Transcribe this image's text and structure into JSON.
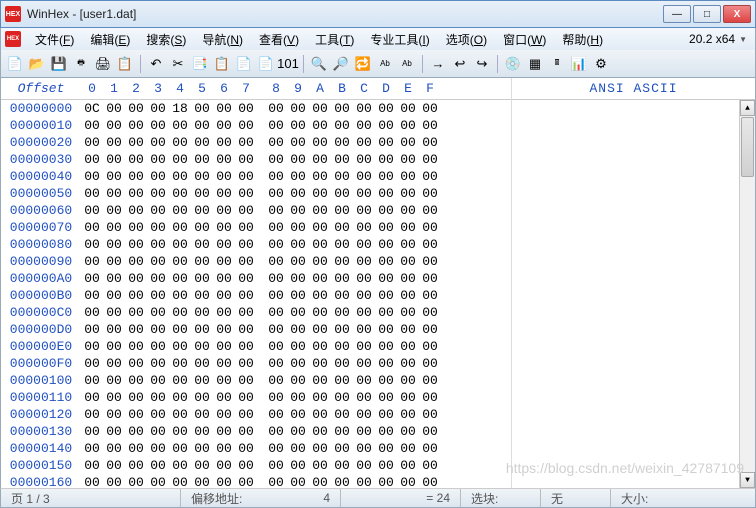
{
  "window": {
    "title": "WinHex - [user1.dat]",
    "app_abbr": "HEX"
  },
  "win_controls": {
    "min": "—",
    "max": "□",
    "close": "X"
  },
  "menu": {
    "items": [
      {
        "label": "文件",
        "key": "F"
      },
      {
        "label": "编辑",
        "key": "E"
      },
      {
        "label": "搜索",
        "key": "S"
      },
      {
        "label": "导航",
        "key": "N"
      },
      {
        "label": "查看",
        "key": "V"
      },
      {
        "label": "工具",
        "key": "T"
      },
      {
        "label": "专业工具",
        "key": "I"
      },
      {
        "label": "选项",
        "key": "O"
      },
      {
        "label": "窗口",
        "key": "W"
      },
      {
        "label": "帮助",
        "key": "H"
      }
    ],
    "version": "20.2 x64"
  },
  "toolbar_icons": [
    {
      "name": "new-file-icon",
      "glyph": "📄"
    },
    {
      "name": "open-folder-icon",
      "glyph": "📂"
    },
    {
      "name": "save-icon",
      "glyph": "💾"
    },
    {
      "name": "save-as-icon",
      "glyph": "🖶"
    },
    {
      "name": "print-icon",
      "glyph": "🖨"
    },
    {
      "name": "properties-icon",
      "glyph": "📋"
    },
    {
      "name": "sep"
    },
    {
      "name": "undo-icon",
      "glyph": "↶"
    },
    {
      "name": "cut-icon",
      "glyph": "✂"
    },
    {
      "name": "copy-icon",
      "glyph": "📑"
    },
    {
      "name": "paste-icon",
      "glyph": "📋"
    },
    {
      "name": "copy-block-icon",
      "glyph": "📄"
    },
    {
      "name": "paste-block-icon",
      "glyph": "📄"
    },
    {
      "name": "binary-icon",
      "glyph": "101"
    },
    {
      "name": "sep"
    },
    {
      "name": "find-icon",
      "glyph": "🔍"
    },
    {
      "name": "find-hex-icon",
      "glyph": "🔎"
    },
    {
      "name": "replace-icon",
      "glyph": "🔁"
    },
    {
      "name": "find-text-icon",
      "glyph": "Ab"
    },
    {
      "name": "replace-text-icon",
      "glyph": "Ab"
    },
    {
      "name": "sep"
    },
    {
      "name": "goto-icon",
      "glyph": "→"
    },
    {
      "name": "back-icon",
      "glyph": "↩"
    },
    {
      "name": "forward-icon",
      "glyph": "↪"
    },
    {
      "name": "sep"
    },
    {
      "name": "disk-icon",
      "glyph": "💿"
    },
    {
      "name": "ram-icon",
      "glyph": "▦"
    },
    {
      "name": "calc-icon",
      "glyph": "🖩"
    },
    {
      "name": "analyze-icon",
      "glyph": "📊"
    },
    {
      "name": "settings-icon",
      "glyph": "⚙"
    }
  ],
  "hex": {
    "offset_label": "Offset",
    "columns": [
      "0",
      "1",
      "2",
      "3",
      "4",
      "5",
      "6",
      "7",
      "8",
      "9",
      "A",
      "B",
      "C",
      "D",
      "E",
      "F"
    ],
    "ascii_label": "ANSI ASCII",
    "rows": [
      {
        "offset": "00000000",
        "bytes": [
          "0C",
          "00",
          "00",
          "00",
          "18",
          "00",
          "00",
          "00",
          "00",
          "00",
          "00",
          "00",
          "00",
          "00",
          "00",
          "00"
        ]
      },
      {
        "offset": "00000010",
        "bytes": [
          "00",
          "00",
          "00",
          "00",
          "00",
          "00",
          "00",
          "00",
          "00",
          "00",
          "00",
          "00",
          "00",
          "00",
          "00",
          "00"
        ]
      },
      {
        "offset": "00000020",
        "bytes": [
          "00",
          "00",
          "00",
          "00",
          "00",
          "00",
          "00",
          "00",
          "00",
          "00",
          "00",
          "00",
          "00",
          "00",
          "00",
          "00"
        ]
      },
      {
        "offset": "00000030",
        "bytes": [
          "00",
          "00",
          "00",
          "00",
          "00",
          "00",
          "00",
          "00",
          "00",
          "00",
          "00",
          "00",
          "00",
          "00",
          "00",
          "00"
        ]
      },
      {
        "offset": "00000040",
        "bytes": [
          "00",
          "00",
          "00",
          "00",
          "00",
          "00",
          "00",
          "00",
          "00",
          "00",
          "00",
          "00",
          "00",
          "00",
          "00",
          "00"
        ]
      },
      {
        "offset": "00000050",
        "bytes": [
          "00",
          "00",
          "00",
          "00",
          "00",
          "00",
          "00",
          "00",
          "00",
          "00",
          "00",
          "00",
          "00",
          "00",
          "00",
          "00"
        ]
      },
      {
        "offset": "00000060",
        "bytes": [
          "00",
          "00",
          "00",
          "00",
          "00",
          "00",
          "00",
          "00",
          "00",
          "00",
          "00",
          "00",
          "00",
          "00",
          "00",
          "00"
        ]
      },
      {
        "offset": "00000070",
        "bytes": [
          "00",
          "00",
          "00",
          "00",
          "00",
          "00",
          "00",
          "00",
          "00",
          "00",
          "00",
          "00",
          "00",
          "00",
          "00",
          "00"
        ]
      },
      {
        "offset": "00000080",
        "bytes": [
          "00",
          "00",
          "00",
          "00",
          "00",
          "00",
          "00",
          "00",
          "00",
          "00",
          "00",
          "00",
          "00",
          "00",
          "00",
          "00"
        ]
      },
      {
        "offset": "00000090",
        "bytes": [
          "00",
          "00",
          "00",
          "00",
          "00",
          "00",
          "00",
          "00",
          "00",
          "00",
          "00",
          "00",
          "00",
          "00",
          "00",
          "00"
        ]
      },
      {
        "offset": "000000A0",
        "bytes": [
          "00",
          "00",
          "00",
          "00",
          "00",
          "00",
          "00",
          "00",
          "00",
          "00",
          "00",
          "00",
          "00",
          "00",
          "00",
          "00"
        ]
      },
      {
        "offset": "000000B0",
        "bytes": [
          "00",
          "00",
          "00",
          "00",
          "00",
          "00",
          "00",
          "00",
          "00",
          "00",
          "00",
          "00",
          "00",
          "00",
          "00",
          "00"
        ]
      },
      {
        "offset": "000000C0",
        "bytes": [
          "00",
          "00",
          "00",
          "00",
          "00",
          "00",
          "00",
          "00",
          "00",
          "00",
          "00",
          "00",
          "00",
          "00",
          "00",
          "00"
        ]
      },
      {
        "offset": "000000D0",
        "bytes": [
          "00",
          "00",
          "00",
          "00",
          "00",
          "00",
          "00",
          "00",
          "00",
          "00",
          "00",
          "00",
          "00",
          "00",
          "00",
          "00"
        ]
      },
      {
        "offset": "000000E0",
        "bytes": [
          "00",
          "00",
          "00",
          "00",
          "00",
          "00",
          "00",
          "00",
          "00",
          "00",
          "00",
          "00",
          "00",
          "00",
          "00",
          "00"
        ]
      },
      {
        "offset": "000000F0",
        "bytes": [
          "00",
          "00",
          "00",
          "00",
          "00",
          "00",
          "00",
          "00",
          "00",
          "00",
          "00",
          "00",
          "00",
          "00",
          "00",
          "00"
        ]
      },
      {
        "offset": "00000100",
        "bytes": [
          "00",
          "00",
          "00",
          "00",
          "00",
          "00",
          "00",
          "00",
          "00",
          "00",
          "00",
          "00",
          "00",
          "00",
          "00",
          "00"
        ]
      },
      {
        "offset": "00000110",
        "bytes": [
          "00",
          "00",
          "00",
          "00",
          "00",
          "00",
          "00",
          "00",
          "00",
          "00",
          "00",
          "00",
          "00",
          "00",
          "00",
          "00"
        ]
      },
      {
        "offset": "00000120",
        "bytes": [
          "00",
          "00",
          "00",
          "00",
          "00",
          "00",
          "00",
          "00",
          "00",
          "00",
          "00",
          "00",
          "00",
          "00",
          "00",
          "00"
        ]
      },
      {
        "offset": "00000130",
        "bytes": [
          "00",
          "00",
          "00",
          "00",
          "00",
          "00",
          "00",
          "00",
          "00",
          "00",
          "00",
          "00",
          "00",
          "00",
          "00",
          "00"
        ]
      },
      {
        "offset": "00000140",
        "bytes": [
          "00",
          "00",
          "00",
          "00",
          "00",
          "00",
          "00",
          "00",
          "00",
          "00",
          "00",
          "00",
          "00",
          "00",
          "00",
          "00"
        ]
      },
      {
        "offset": "00000150",
        "bytes": [
          "00",
          "00",
          "00",
          "00",
          "00",
          "00",
          "00",
          "00",
          "00",
          "00",
          "00",
          "00",
          "00",
          "00",
          "00",
          "00"
        ]
      },
      {
        "offset": "00000160",
        "bytes": [
          "00",
          "00",
          "00",
          "00",
          "00",
          "00",
          "00",
          "00",
          "00",
          "00",
          "00",
          "00",
          "00",
          "00",
          "00",
          "00"
        ]
      }
    ]
  },
  "status": {
    "page": "页 1 / 3",
    "offset_label": "偏移地址:",
    "offset_val": "4",
    "eq": "= 24",
    "sel_label": "选块:",
    "none": "无",
    "size_label": "大小:"
  },
  "watermark": "https://blog.csdn.net/weixin_42787109"
}
